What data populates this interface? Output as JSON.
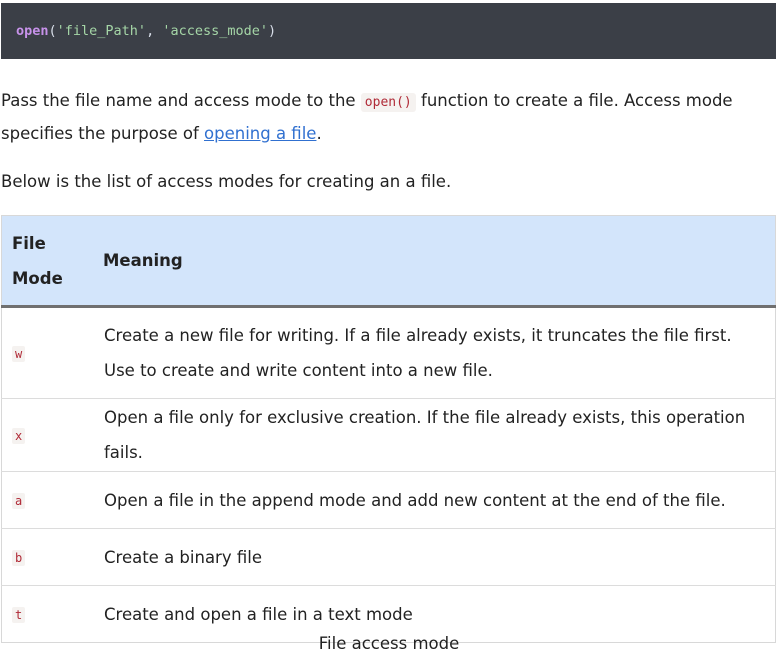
{
  "code": {
    "fn": "open",
    "open_paren": "(",
    "arg1": "'file_Path'",
    "comma": ", ",
    "arg2": "'access_mode'",
    "close_paren": ")"
  },
  "para1": {
    "before": "Pass the file name and access mode to the ",
    "code": "open()",
    "middle": " function to create a file. Access mode specifies the purpose of ",
    "link": "opening a file",
    "after": "."
  },
  "para2": "Below is the list of access modes for creating an a file.",
  "table": {
    "headers": {
      "mode_line1": "File",
      "mode_line2": "Mode",
      "meaning": "Meaning"
    },
    "rows": [
      {
        "mode": "w",
        "meaning": "Create a new file for writing. If a file already exists, it truncates the file first. Use to create and write content into a new file."
      },
      {
        "mode": "x",
        "meaning": "Open a file only for exclusive creation. If the file already exists, this operation fails."
      },
      {
        "mode": "a",
        "meaning": "Open a file in the append mode and add new content at the end of the file."
      },
      {
        "mode": "b",
        "meaning": "Create a binary file"
      },
      {
        "mode": "t",
        "meaning": "Create and open a file in a text mode"
      }
    ]
  },
  "caption": "File access mode"
}
